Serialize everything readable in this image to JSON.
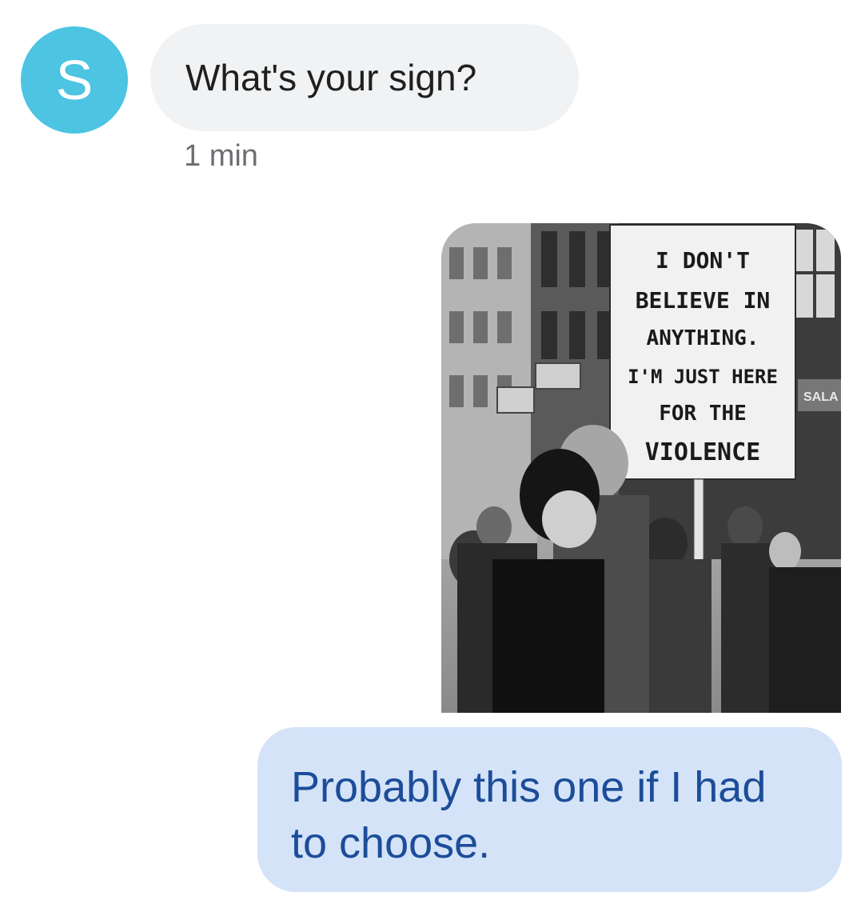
{
  "incoming": {
    "avatar_letter": "S",
    "avatar_color": "#4cc4e2",
    "message": "What's your sign?",
    "timestamp": "1 min"
  },
  "outgoing": {
    "image": {
      "sign_lines": [
        "I DON'T",
        "BELIEVE IN",
        "ANYTHING.",
        "I'M JUST HERE",
        "FOR THE",
        "VIOLENCE"
      ],
      "storefront_text": "SALA"
    },
    "message": "Probably this one if I had to choose.",
    "bubble_color": "#d4e3f8",
    "text_color": "#1c4d9a"
  }
}
